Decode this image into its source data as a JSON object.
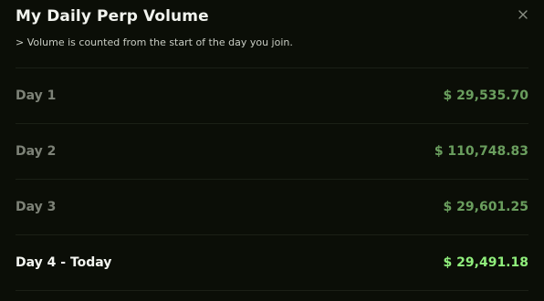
{
  "modal": {
    "title": "My Daily Perp Volume",
    "subtitle": "> Volume is counted from the start of the day you join.",
    "close_icon": "close-icon"
  },
  "rows": [
    {
      "label": "Day 1",
      "value": "$ 29,535.70"
    },
    {
      "label": "Day 2",
      "value": "$ 110,748.83"
    },
    {
      "label": "Day 3",
      "value": "$ 29,601.25"
    },
    {
      "label": "Day 4 - Today",
      "value": "$ 29,491.18"
    }
  ],
  "colors": {
    "background": "#0b0e07",
    "past_value": "#6a9e5e",
    "today_value": "#90ee7c",
    "past_label": "#7d8277",
    "today_label": "#f4f6f1"
  }
}
